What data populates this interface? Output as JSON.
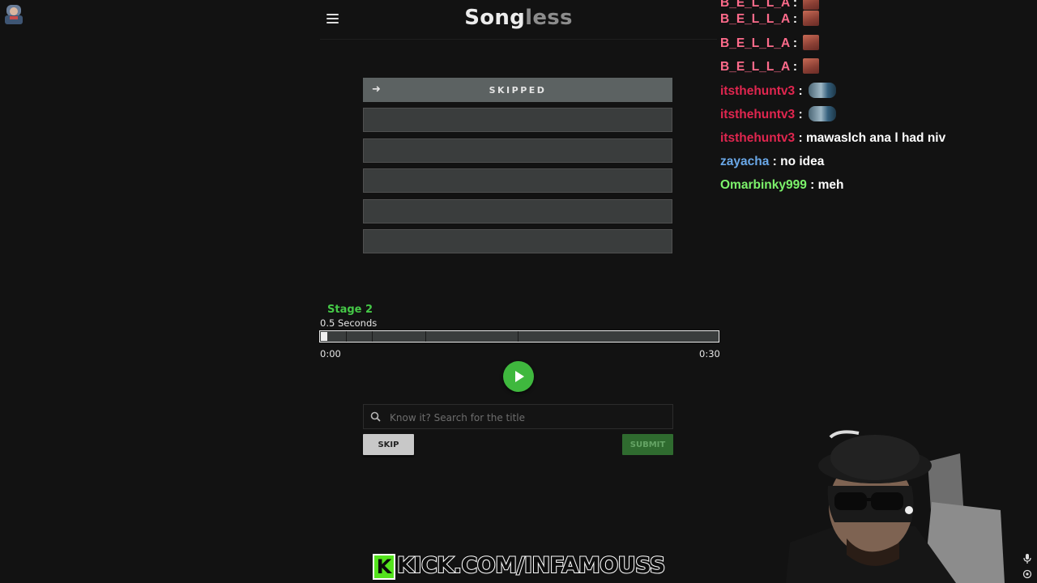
{
  "header": {
    "logo_part1": "Song",
    "logo_part2": "less"
  },
  "guesses": [
    {
      "label": "SKIPPED",
      "status": "skipped"
    },
    {
      "label": "",
      "status": "empty"
    },
    {
      "label": "",
      "status": "empty"
    },
    {
      "label": "",
      "status": "empty"
    },
    {
      "label": "",
      "status": "empty"
    },
    {
      "label": "",
      "status": "empty"
    }
  ],
  "player": {
    "stage_label": "Stage 2",
    "duration_label": "0.5 Seconds",
    "time_start": "0:00",
    "time_end": "0:30",
    "progress_fraction": 0.017
  },
  "search": {
    "placeholder": "Know it? Search for the title",
    "value": ""
  },
  "actions": {
    "skip_label": "SKIP",
    "submit_label": "SUBMIT"
  },
  "chat": {
    "messages": [
      {
        "user": "B_E_L_L_A",
        "color": "#ff6b8b",
        "text": "",
        "emote": "bella"
      },
      {
        "user": "B_E_L_L_A",
        "color": "#ff6b8b",
        "text": "",
        "emote": "bella"
      },
      {
        "user": "B_E_L_L_A",
        "color": "#ff6b8b",
        "text": "",
        "emote": "bella"
      },
      {
        "user": "itsthehuntv3",
        "color": "#e0264f",
        "text": "",
        "emote": "hunt"
      },
      {
        "user": "itsthehuntv3",
        "color": "#e0264f",
        "text": "",
        "emote": "hunt"
      },
      {
        "user": "itsthehuntv3",
        "color": "#e0264f",
        "text": "mawaslch ana l had niv",
        "emote": ""
      },
      {
        "user": "zayacha",
        "color": "#6aa8e8",
        "text": "no idea",
        "emote": ""
      },
      {
        "user": "Omarbinky999",
        "color": "#7cf26b",
        "text": "meh",
        "emote": ""
      }
    ]
  },
  "overlay": {
    "kick_letter": "K",
    "kick_text": "KICK.COM/INFAMOUSS"
  },
  "colors": {
    "accent_green": "#3fb83e",
    "stage_green": "#45c947",
    "background": "#121212"
  },
  "icons": {
    "menu": "hamburger-menu-icon",
    "arrow": "arrow-right-icon",
    "play": "play-icon",
    "search": "search-icon",
    "mic": "microphone-icon",
    "settings": "settings-icon"
  }
}
